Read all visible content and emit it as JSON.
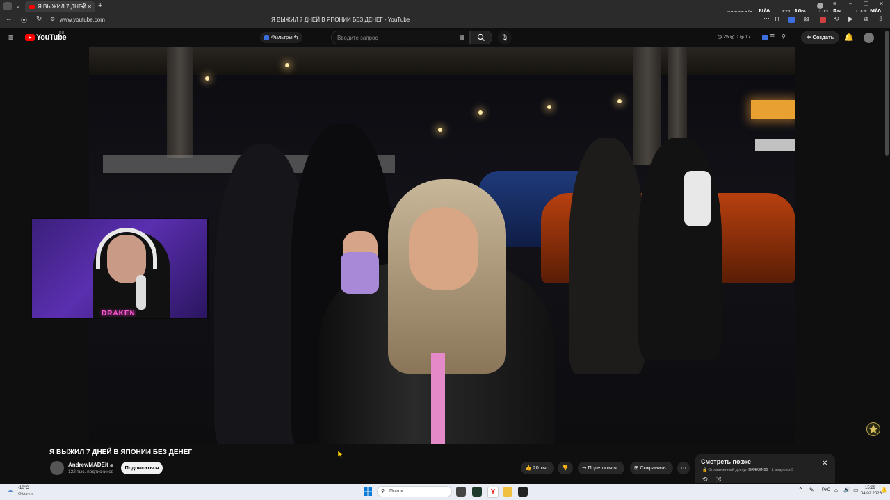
{
  "browser": {
    "tab_title": "Я ВЫЖИЛ 7 ДНЕЙ",
    "url": "www.youtube.com",
    "page_title": "Я ВЫЖИЛ 7 ДНЕЙ В ЯПОНИИ БЕЗ ДЕНЕГ - YouTube"
  },
  "overlay_stats": {
    "fps_label": "кадров/с",
    "fps_value": "N/A",
    "gpu_label": "ГП",
    "gpu_value": "10",
    "gpu_unit": "%",
    "cpu_label": "ЦП",
    "cpu_value": "5",
    "cpu_unit": "%",
    "lat_label": "LAT",
    "lat_value": "N/A"
  },
  "youtube": {
    "logo_text": "YouTube",
    "logo_region": "RU",
    "filters_label": "Фильтры",
    "search_placeholder": "Введите запрос",
    "counter_a": "25",
    "counter_b": "0",
    "counter_c": "17",
    "create_label": "Создать"
  },
  "video": {
    "title": "Я ВЫЖИЛ 7 ДНЕЙ В ЯПОНИИ БЕЗ ДЕНЕГ",
    "webcam_label": "DRAKEN",
    "channel_name": "AndrewMADEit",
    "subscribers": "122 тыс. подписчиков",
    "subscribe_label": "Подписаться",
    "likes": "20 тыс.",
    "share_label": "Поделиться",
    "save_label": "Сохранить"
  },
  "watch_later": {
    "title": "Смотреть позже",
    "subtitle_prefix": "Ограниченный доступ",
    "owner": "DR4KEN99",
    "position": "1 видео из 5"
  },
  "taskbar": {
    "weather_temp": "-10°C",
    "weather_desc": "Облачно",
    "search_label": "Поиск",
    "lang": "РУС",
    "time": "15:29",
    "date": "04.02.2026"
  }
}
